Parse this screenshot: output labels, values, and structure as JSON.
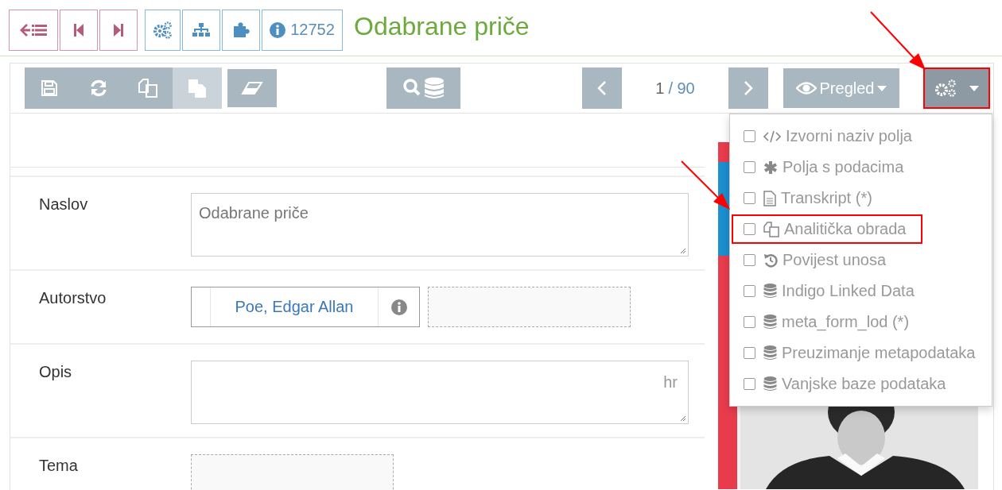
{
  "header": {
    "record_id": "12752",
    "title": "Odabrane priče"
  },
  "toolbar": {
    "edit_buttons": [
      {
        "kind": "save",
        "disabled": false
      },
      {
        "kind": "refresh",
        "disabled": false
      },
      {
        "kind": "copy",
        "disabled": false
      },
      {
        "kind": "paste",
        "disabled": true
      }
    ],
    "pager": {
      "current": "1",
      "total": "/ 90"
    },
    "view_button": {
      "label": "Pregled"
    },
    "settings_button": {
      "highlighted": true
    }
  },
  "settings_menu": [
    {
      "kind": "code",
      "label": "Izvorni naziv polja",
      "checked": false,
      "highlighted": false
    },
    {
      "kind": "asterisk",
      "label": "Polja s podacima",
      "checked": false,
      "highlighted": false
    },
    {
      "kind": "file",
      "label": "Transkript (*)",
      "checked": false,
      "highlighted": false
    },
    {
      "kind": "copy",
      "label": "Analitička obrada",
      "checked": false,
      "highlighted": true
    },
    {
      "kind": "history",
      "label": "Povijest unosa",
      "checked": false,
      "highlighted": false
    },
    {
      "kind": "database",
      "label": "Indigo Linked Data",
      "checked": false,
      "highlighted": false
    },
    {
      "kind": "database",
      "label": "meta_form_lod (*)",
      "checked": false,
      "highlighted": false
    },
    {
      "kind": "database",
      "label": "Preuzimanje metapodataka",
      "checked": false,
      "highlighted": false
    },
    {
      "kind": "database",
      "label": "Vanjske baze podataka",
      "checked": false,
      "highlighted": false
    }
  ],
  "form": [
    {
      "label": "Naslov",
      "kind": "textarea",
      "value": "Odabrane priče"
    },
    {
      "label": "Autorstvo",
      "kind": "author",
      "value": "Poe, Edgar Allan"
    },
    {
      "label": "Opis",
      "kind": "textarea",
      "lang": "hr"
    },
    {
      "label": "Tema",
      "kind": "empty"
    }
  ]
}
